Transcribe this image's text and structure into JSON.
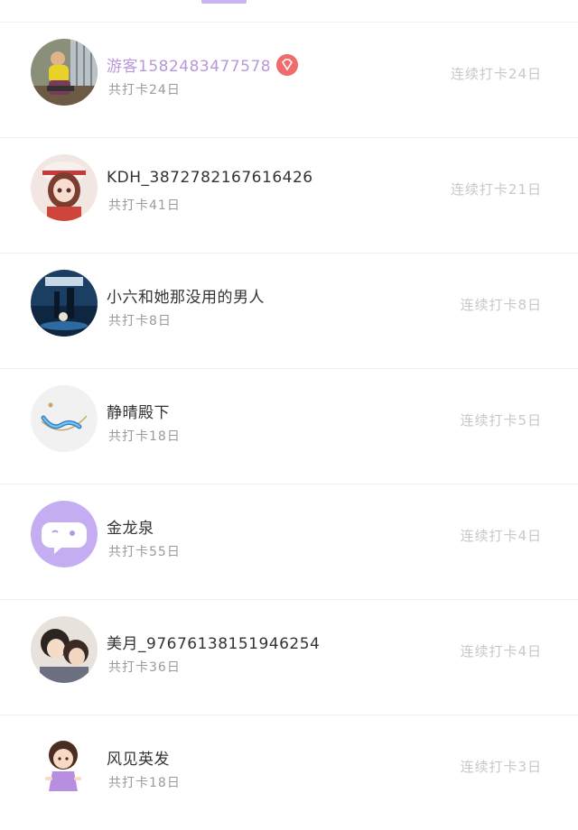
{
  "accent": "#c9b5ef",
  "items": [
    {
      "name": "游客1582483477578",
      "vip": true,
      "total": "共打卡24日",
      "streak": "连续打卡24日",
      "avatar": "photo-child-icon"
    },
    {
      "name": "KDH_3872782167616426",
      "vip": false,
      "total": "共打卡41日",
      "streak": "连续打卡21日",
      "avatar": "anime-girl-icon"
    },
    {
      "name": "小六和她那没用的男人",
      "vip": false,
      "total": "共打卡8日",
      "streak": "连续打卡8日",
      "avatar": "game-poster-icon"
    },
    {
      "name": "静晴殿下",
      "vip": false,
      "total": "共打卡18日",
      "streak": "连续打卡5日",
      "avatar": "bracelet-icon"
    },
    {
      "name": "金龙泉",
      "vip": false,
      "total": "共打卡55日",
      "streak": "连续打卡4日",
      "avatar": "chat-bubble-icon"
    },
    {
      "name": "美月_97676138151946254",
      "vip": false,
      "total": "共打卡36日",
      "streak": "连续打卡4日",
      "avatar": "anime-couple-icon"
    },
    {
      "name": "风见英发",
      "vip": false,
      "total": "共打卡18日",
      "streak": "连续打卡3日",
      "avatar": "cartoon-girl-icon"
    }
  ]
}
